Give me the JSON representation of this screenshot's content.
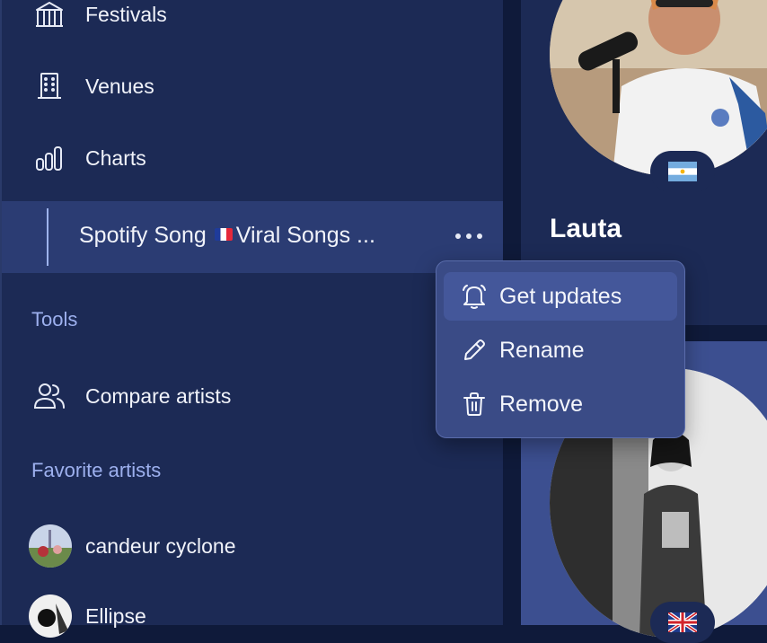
{
  "sidebar": {
    "nav": [
      {
        "label": "Festivals",
        "icon": "tent-icon"
      },
      {
        "label": "Venues",
        "icon": "building-icon"
      },
      {
        "label": "Charts",
        "icon": "bar-chart-icon"
      }
    ],
    "selected_item": {
      "label_prefix": "Spotify Song",
      "label_suffix": "Viral Songs ...",
      "flag": "france-flag-icon"
    },
    "tools_title": "Tools",
    "compare_label": "Compare artists",
    "favorites_title": "Favorite artists",
    "favorites": [
      {
        "name": "candeur cyclone"
      },
      {
        "name": "Ellipse"
      }
    ]
  },
  "main": {
    "artist_name": "Lauta",
    "card1_flag": "argentina-flag-icon",
    "card2_flag": "uk-flag-icon"
  },
  "menu": {
    "items": [
      {
        "label": "Get updates",
        "icon": "bell-icon"
      },
      {
        "label": "Rename",
        "icon": "pencil-icon"
      },
      {
        "label": "Remove",
        "icon": "trash-icon"
      }
    ]
  },
  "colors": {
    "sidebar_bg": "#1c2a55",
    "selected_bg": "#2b3c73",
    "menu_bg": "#3a4b86",
    "section_title": "#9db0ee"
  }
}
